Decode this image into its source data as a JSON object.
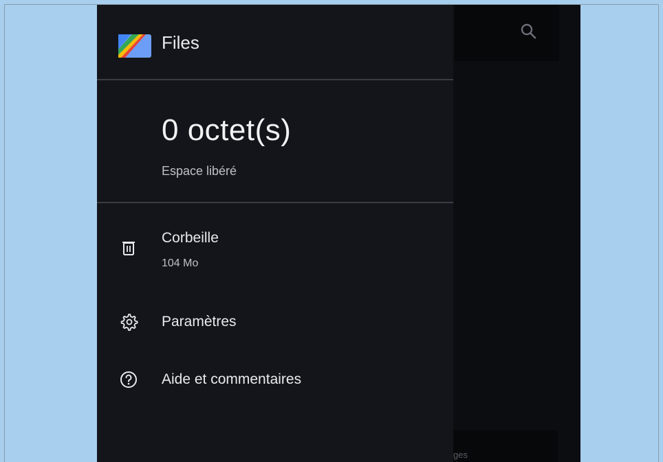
{
  "drawer": {
    "app_title": "Files",
    "freed_value": "0 octet(s)",
    "freed_label": "Espace libéré",
    "items": [
      {
        "icon": "trash-icon",
        "label": "Corbeille",
        "sub": "104 Mo"
      },
      {
        "icon": "gear-icon",
        "label": "Paramètres"
      },
      {
        "icon": "help-icon",
        "label": "Aide et commentaires"
      }
    ]
  },
  "background": {
    "bottom_chip_text": "ges"
  },
  "colors": {
    "page_background": "#a8cfee",
    "drawer_background": "#13151a",
    "app_background": "#0c0d10",
    "text_primary": "#e8eaed",
    "text_secondary": "#bdc1c6"
  }
}
